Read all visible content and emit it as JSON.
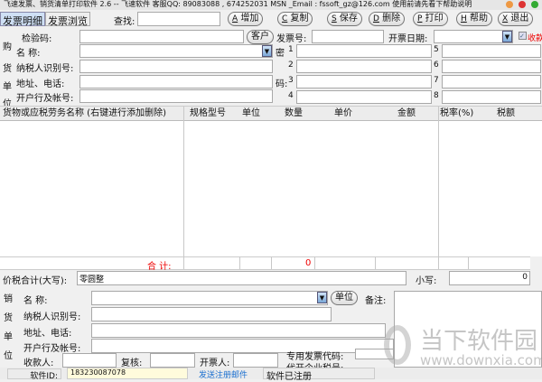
{
  "title": "飞速发票、销货清单打印软件 2.6  -- 飞速软件  客服QQ:  89083088 , 674252031  MSN _Email : fssoft_gz@126.com  使用前请先看下帮助说明",
  "tabs": [
    "发票明细",
    "发票浏览"
  ],
  "search_label": "查找:",
  "search_value": "",
  "toolbar": [
    {
      "key": "A",
      "label": "增加"
    },
    {
      "key": "C",
      "label": "复制"
    },
    {
      "key": "S",
      "label": "保存"
    },
    {
      "key": "D",
      "label": "删除"
    },
    {
      "key": "P",
      "label": "打印"
    },
    {
      "key": "H",
      "label": "帮助"
    },
    {
      "key": "X",
      "label": "退出"
    }
  ],
  "buyer": {
    "side_label": [
      "购",
      "货",
      "单",
      "位"
    ],
    "check_code": "检验码:",
    "name": "名    称:",
    "tax_id": "纳税人识别号:",
    "address": "地址、电话:",
    "bank": "开户行及帐号:",
    "customer_btn": "客户"
  },
  "invoice_no_label": "发票号:",
  "date_label": "开票日期:",
  "receipt_label": "收款",
  "cipher": {
    "label_top": "密",
    "label_bottom": "码:",
    "numbers": [
      "1",
      "2",
      "3",
      "4",
      "5",
      "6",
      "7",
      "8"
    ]
  },
  "columns": [
    "货物或应税劳务名称 (右键进行添加删除)",
    "规格型号",
    "单位",
    "数量",
    "单价",
    "金额",
    "税率(%)",
    "税额"
  ],
  "total": {
    "label": "合  计:",
    "amount": "0"
  },
  "tax_total": {
    "label": "价税合计(大写):",
    "upper": "零圆整",
    "lower_label": "小写:",
    "lower": "0"
  },
  "seller": {
    "side_label": [
      "销",
      "货",
      "单",
      "位"
    ],
    "name": "名    称:",
    "unit_btn": "单位",
    "remark": "备注:",
    "tax_id": "纳税人识别号:",
    "address": "地址、电话:",
    "bank": "开户行及帐号:"
  },
  "signers": {
    "payee": "收款人:",
    "review": "复核:",
    "drawer": "开票人:",
    "special_code": "专用发票代码:",
    "agent_tax": "代开企业税号:"
  },
  "status": {
    "id_label": "软件ID:",
    "id": "183230087078",
    "email_link": "发送注册邮件",
    "registered": "软件已注册"
  },
  "watermark": {
    "cn": "当下软件园",
    "url": "www.downxia.com"
  }
}
